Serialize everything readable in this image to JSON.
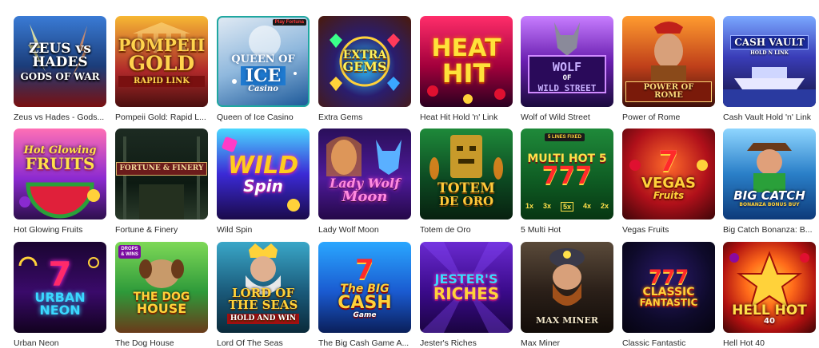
{
  "games": [
    {
      "title": "Zeus vs Hades - Gods...",
      "logo": [
        "ZEUS vs HADES",
        "GODS OF WAR"
      ],
      "icon": "zeus-art-icon"
    },
    {
      "title": "Pompeii Gold: Rapid L...",
      "logo": [
        "POMPEII",
        "GOLD",
        "RAPID LINK"
      ],
      "icon": "temple-art-icon"
    },
    {
      "title": "Queen of Ice Casino",
      "logo": [
        "QUEEN OF",
        "ICE",
        "Casino"
      ],
      "badge": "Play Fortuna",
      "icon": "ice-queen-art-icon"
    },
    {
      "title": "Extra Gems",
      "logo": [
        "EXTRA",
        "GEMS"
      ],
      "icon": "gem-art-icon"
    },
    {
      "title": "Heat Hit Hold 'n' Link",
      "logo": [
        "HEAT",
        "HIT"
      ],
      "icon": "fruit-art-icon"
    },
    {
      "title": "Wolf of Wild Street",
      "logo": [
        "WOLF",
        "OF",
        "WILD STREET"
      ],
      "icon": "wolf-art-icon"
    },
    {
      "title": "Power of Rome",
      "logo": [
        "POWER OF ROME"
      ],
      "icon": "centurion-art-icon"
    },
    {
      "title": "Cash Vault Hold 'n' Link",
      "logo": [
        "CASH VAULT",
        "HOLD N LINK"
      ],
      "icon": "yacht-art-icon"
    },
    {
      "title": "Hot Glowing Fruits",
      "logo": [
        "Hot Glowing",
        "FRUITS"
      ],
      "icon": "watermelon-art-icon"
    },
    {
      "title": "Fortune & Finery",
      "logo": [
        "FORTUNE & FINERY"
      ],
      "icon": "gate-art-icon"
    },
    {
      "title": "Wild Spin",
      "logo": [
        "WILD",
        "Spin"
      ],
      "icon": "slot-art-icon"
    },
    {
      "title": "Lady Wolf Moon",
      "logo": [
        "Lady Wolf",
        "Moon"
      ],
      "icon": "lady-wolf-art-icon"
    },
    {
      "title": "Totem de Oro",
      "logo": [
        "TOTEM",
        "DE ORO"
      ],
      "icon": "totem-art-icon"
    },
    {
      "title": "5 Multi Hot",
      "logo": [
        "MULTI HOT 5",
        "777"
      ],
      "badge": "5 LINES FIXED",
      "multipliers": [
        "1x",
        "3x",
        "5x",
        "4x",
        "2x"
      ],
      "icon": "sevens-art-icon"
    },
    {
      "title": "Vegas Fruits",
      "logo": [
        "7",
        "VEGAS",
        "Fruits"
      ],
      "icon": "seven-art-icon"
    },
    {
      "title": "Big Catch Bonanza: B...",
      "logo": [
        "BIG CATCH",
        "BONANZA BONUS BUY"
      ],
      "icon": "fisherman-art-icon"
    },
    {
      "title": "Urban Neon",
      "logo": [
        "7",
        "URBAN NEON"
      ],
      "icon": "neon-seven-art-icon"
    },
    {
      "title": "The Dog House",
      "logo": [
        "THE DOG",
        "HOUSE"
      ],
      "badge": "DROPS & WINS",
      "icon": "dog-art-icon"
    },
    {
      "title": "Lord Of The Seas",
      "logo": [
        "LORD OF",
        "THE SEAS",
        "HOLD AND WIN"
      ],
      "icon": "poseidon-art-icon"
    },
    {
      "title": "The Big Cash Game A...",
      "logo": [
        "7",
        "The BIG",
        "CASH",
        "Game"
      ],
      "icon": "big-seven-art-icon"
    },
    {
      "title": "Jester's Riches",
      "logo": [
        "JESTER'S",
        "RICHES"
      ],
      "icon": "jester-art-icon"
    },
    {
      "title": "Max Miner",
      "logo": [
        "MAX MINER"
      ],
      "icon": "miner-art-icon"
    },
    {
      "title": "Classic Fantastic",
      "logo": [
        "777",
        "CLASSIC",
        "FANTASTIC"
      ],
      "icon": "classic-seven-art-icon"
    },
    {
      "title": "Hell Hot 40",
      "logo": [
        "HELL HOT",
        "40"
      ],
      "icon": "star-art-icon"
    }
  ]
}
